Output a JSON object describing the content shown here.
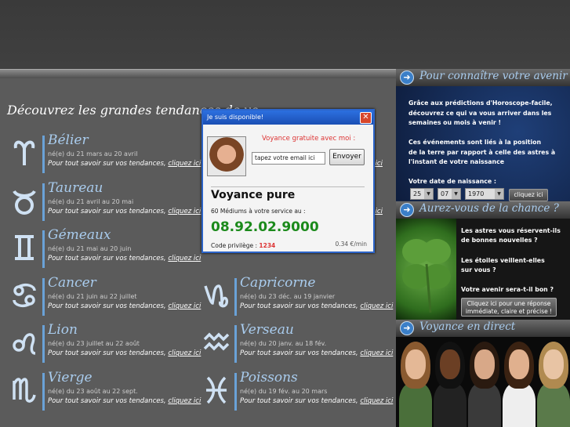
{
  "main": {
    "title": "Découvrez les grandes tendances de vo",
    "cta_prefix": "Pour tout savoir sur vos tendances, ",
    "cta_link": "cliquez ici",
    "signs": [
      {
        "name": "Bélier",
        "dates": "né(e) du 21 mars au 20 avril",
        "icon": "aries-icon"
      },
      {
        "name": "Taureau",
        "dates": "né(e) du 21 avril au 20 mai",
        "icon": "taurus-icon"
      },
      {
        "name": "Gémeaux",
        "dates": "né(e) du 21 mai au 20 juin",
        "icon": "gemini-icon"
      },
      {
        "name": "Cancer",
        "dates": "né(e) du 21 juin au 22 juillet",
        "icon": "cancer-icon"
      },
      {
        "name": "Lion",
        "dates": "né(e) du 23 juillet au 22 août",
        "icon": "leo-icon"
      },
      {
        "name": "Vierge",
        "dates": "né(e) du 23 août au 22 sept.",
        "icon": "virgo-icon"
      },
      {
        "name": "Capricorne",
        "dates": "né(e) du 23 déc. au 19 janvier",
        "icon": "capricorn-icon"
      },
      {
        "name": "Verseau",
        "dates": "né(e) du 20 janv. au 18 fév.",
        "icon": "aquarius-icon"
      },
      {
        "name": "Poissons",
        "dates": "né(e) du 19 fév. au 20 mars",
        "icon": "pisces-icon"
      }
    ]
  },
  "popup": {
    "title": "Je suis disponible!",
    "lead": "Voyance gratuite avec moi :",
    "email_value": "tapez votre email ici",
    "send_label": "Envoyer",
    "heading": "Voyance pure",
    "subtitle": "60 Médiums à votre service au :",
    "phone": "08.92.02.9000",
    "code_label": "Code privilège : ",
    "code": "1234",
    "price": "0.34 €/min"
  },
  "sidebar": {
    "section1_title": "Pour connaître votre avenir !",
    "para1": [
      "Grâce aux prédictions d'Horoscope-facile,",
      "découvrez ce qui va vous arriver dans les",
      "semaines ou mois à venir !"
    ],
    "para2": [
      "Ces événements sont liés à la position",
      "de la terre par rapport à celle des astres à",
      "l'instant de votre naissance"
    ],
    "birth_label": "Votre date de naissance :",
    "day": "25",
    "month": "07",
    "year": "1970",
    "go_label": "cliquez ici",
    "section2_title": "Aurez-vous de la chance ?",
    "q1": [
      "Les astres vous réservent-ils",
      "de bonnes nouvelles ?"
    ],
    "q2": [
      "Les étoiles veillent-elles",
      "sur vous ?"
    ],
    "q3": "Votre avenir sera-t-il bon ?",
    "btn2": [
      "Cliquez ici pour une réponse",
      "immédiate, claire et précise !"
    ],
    "section3_title": "Voyance en direct"
  },
  "colors": {
    "accent": "#a9ccee",
    "bar": "#6aa2d8",
    "phone": "#1b8a1b",
    "code": "#dd3333"
  }
}
